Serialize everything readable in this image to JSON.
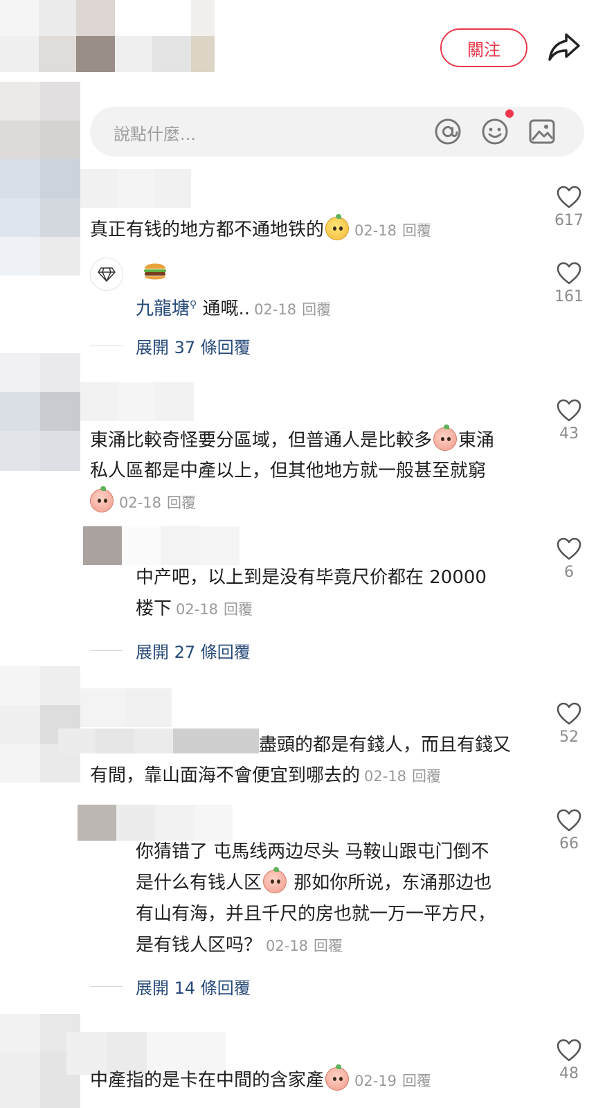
{
  "header": {
    "follow_label": "關注",
    "share_icon": "share-arrow-icon"
  },
  "input": {
    "placeholder": "說點什麼...",
    "icons": [
      "at-icon",
      "emoji-icon",
      "image-icon"
    ]
  },
  "comments": [
    {
      "text": "真正有钱的地方都不通地铁的",
      "date": "02-18",
      "reply_label": "回覆",
      "likes": "617",
      "replies": [
        {
          "username": "九龍塘",
          "text": "通嘅..",
          "date": "02-18",
          "reply_label": "回覆",
          "likes": "161"
        }
      ],
      "expand_label": "展開 37 條回覆"
    },
    {
      "text_line1": "東涌比較奇怪要分區域，但普通人是比較多",
      "text_line1b": "東涌",
      "text_line2": "私人區都是中產以上，但其他地方就一般甚至就窮",
      "date": "02-18",
      "reply_label": "回覆",
      "likes": "43",
      "replies": [
        {
          "text_line1": "中产吧，以上到是没有毕竟尺价都在 20000",
          "text_line2": "楼下",
          "date": "02-18",
          "reply_label": "回覆",
          "likes": "6"
        }
      ],
      "expand_label": "展開 27 條回覆"
    },
    {
      "text_line1": "盡頭的都是有錢人，而且有錢又",
      "text_line2": "有間，靠山面海不會便宜到哪去的",
      "date": "02-18",
      "reply_label": "回覆",
      "likes": "52",
      "replies": [
        {
          "text_line1": "你猜错了 屯馬线两边尽头 马鞍山跟屯门倒不",
          "text_line2a": "是什么有钱人区",
          "text_line2b": " 那如你所说，东涌那边也",
          "text_line3": "有山有海，并且千尺的房也就一万一平方尺，",
          "text_line4": "是有钱人区吗？",
          "date": "02-18",
          "reply_label": "回覆",
          "likes": "66"
        }
      ],
      "expand_label": "展開 14 條回覆"
    },
    {
      "text": "中產指的是卡在中間的含家產",
      "date": "02-19",
      "reply_label": "回覆",
      "likes": "48"
    }
  ],
  "colors": {
    "accent_red": "#e8394a",
    "link_blue": "#274a7a",
    "meta_grey": "#9a9a9a"
  }
}
